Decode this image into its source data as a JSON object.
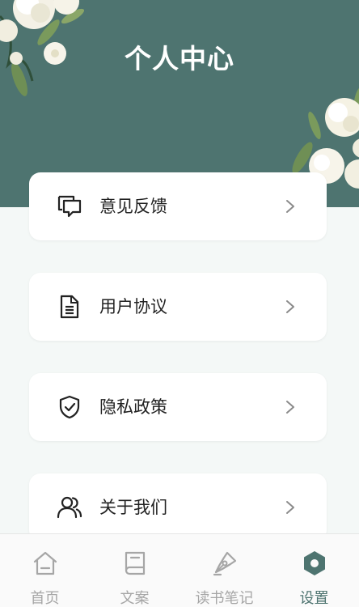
{
  "header": {
    "title": "个人中心"
  },
  "menu": [
    {
      "label": "意见反馈",
      "icon": "chat-bubbles-icon"
    },
    {
      "label": "用户协议",
      "icon": "document-icon"
    },
    {
      "label": "隐私政策",
      "icon": "shield-check-icon"
    },
    {
      "label": "关于我们",
      "icon": "users-icon"
    }
  ],
  "tabbar": [
    {
      "label": "首页",
      "icon": "home-icon",
      "active": false
    },
    {
      "label": "文案",
      "icon": "book-icon",
      "active": false
    },
    {
      "label": "读书笔记",
      "icon": "pen-nib-icon",
      "active": false
    },
    {
      "label": "设置",
      "icon": "hexagon-settings-icon",
      "active": true
    }
  ],
  "colors": {
    "accent": "#4e7470",
    "inactive": "#a6a6a6",
    "background": "#f4f8f7"
  }
}
